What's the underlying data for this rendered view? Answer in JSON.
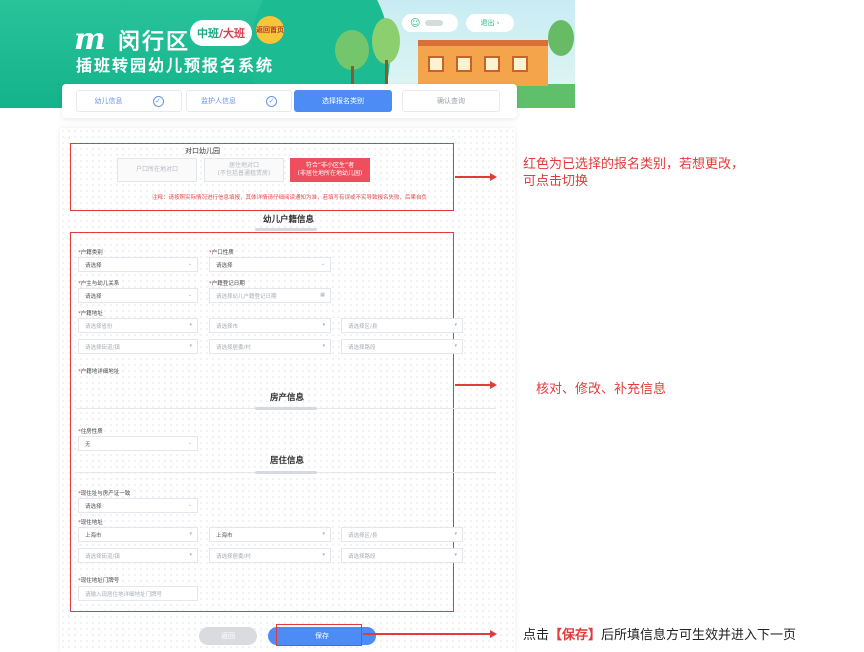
{
  "header": {
    "logo_mark": "m",
    "district": "闵行区",
    "class_pill_a": "中班",
    "class_pill_b": "/大班",
    "home_badge": "返回首页",
    "subtitle": "插班转园幼儿预报名系统",
    "logout": "退出"
  },
  "steps": [
    {
      "label": "幼儿信息",
      "state": "done"
    },
    {
      "label": "监护人信息",
      "state": "done"
    },
    {
      "label": "选择报名类别",
      "state": "active"
    },
    {
      "label": "确认查询",
      "state": "todo"
    }
  ],
  "category": {
    "title": "对口幼儿园",
    "options": [
      {
        "label": "户口所在地对口",
        "selected": false
      },
      {
        "label": "居住地对口\n(不包括普通租赁房)",
        "selected": false
      },
      {
        "label": "符合“非小区生”者\n(非居住地所在地幼儿园)",
        "selected": true
      }
    ],
    "notice": "注释：请按照实际情况进行信息填报，其体详情请仔细阅读通知为准，若填写有误或不实导致报名失败，后果自负"
  },
  "household": {
    "title": "幼儿户籍信息",
    "household_type_label": "户籍类别",
    "household_type_value": "请选择",
    "hukou_nature_label": "户口性质",
    "hukou_nature_value": "请选择",
    "relation_label": "户主与幼儿关系",
    "relation_value": "请选择",
    "register_date_label": "户籍登记日期",
    "register_date_placeholder": "请选择幼儿户籍登记日期",
    "address_label": "户籍地址",
    "province_placeholder": "请选择省份",
    "city_placeholder": "请选择市",
    "district_placeholder": "请选择区/县",
    "street_placeholder": "请选择街道/镇",
    "village_placeholder": "请选择居委/村",
    "road_placeholder": "请选择路段",
    "detail_label": "户籍地详细地址"
  },
  "property": {
    "title": "房产信息",
    "housing_label": "住房性质",
    "housing_value": "无"
  },
  "residence": {
    "title": "居住信息",
    "consistent_label": "现住址与房产证一致",
    "consistent_value": "请选择",
    "address_label": "现住地址",
    "city_value": "上海市",
    "city2_value": "上海市",
    "district_placeholder": "请选择区/县",
    "street_placeholder": "请选择街道/镇",
    "village_placeholder": "请选择居委/村",
    "road_placeholder": "请选择路段",
    "doorplate_label": "现住地址门牌号",
    "doorplate_placeholder": "请输入现居住地详细地址门牌号"
  },
  "buttons": {
    "back": "返回",
    "save": "保存"
  },
  "annotations": {
    "category_note_line1": "红色为已选择的报名类别，若想更改，",
    "category_note_line2": "可点击切换",
    "form_note": "核对、修改、补充信息",
    "save_note_pre": "点击",
    "save_note_key": "【保存】",
    "save_note_post": "后所填信息方可生效并进入下一页"
  },
  "colors": {
    "brand_green": "#1dbb91",
    "primary_blue": "#4e8cf5",
    "selected_red": "#ee4e5d",
    "annotation_red": "#e23b3b"
  }
}
